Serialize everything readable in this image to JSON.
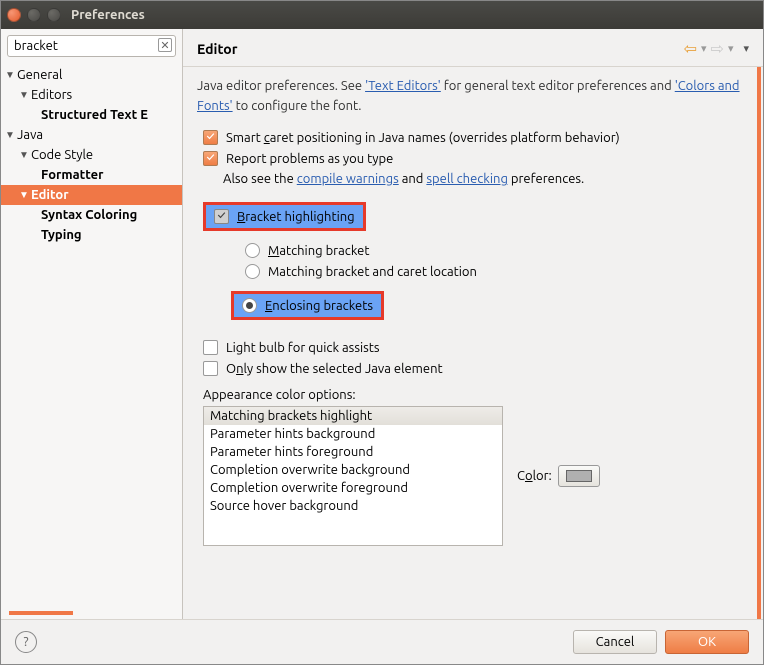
{
  "window": {
    "title": "Preferences"
  },
  "search": {
    "value": "bracket"
  },
  "tree": {
    "general": "General",
    "editors": "Editors",
    "structured": "Structured Text E",
    "java": "Java",
    "codestyle": "Code Style",
    "formatter": "Formatter",
    "editor": "Editor",
    "syntax": "Syntax Coloring",
    "typing": "Typing"
  },
  "header": {
    "title": "Editor"
  },
  "help": {
    "prefix": "Java editor preferences. See ",
    "link1": "'Text Editors'",
    "mid": " for general text editor preferences and ",
    "link2": "'Colors and Fonts'",
    "suffix": " to configure the font."
  },
  "opts": {
    "caret_pre": "Smart ",
    "caret_u": "c",
    "caret_post": "aret positioning in Java names (overrides platform behavior)",
    "report": "Report problems as you type",
    "also_pre": "Also see the ",
    "also_l1": "compile warnings",
    "also_mid": " and ",
    "also_l2": "spell checking",
    "also_post": " preferences.",
    "bracket_u": "B",
    "bracket_post": "racket highlighting",
    "matching_u": "M",
    "matching_post": "atching bracket",
    "matchloc": "Matching bracket and caret location",
    "encl_u": "E",
    "encl_post": "nclosing brackets",
    "bulb": "Light bulb for quick assists",
    "only_pre": "O",
    "only_u": "n",
    "only_post": "ly show the selected Java element"
  },
  "aco": {
    "label": "Appearance color options:",
    "items": [
      "Matching brackets highlight",
      "Parameter hints background",
      "Parameter hints foreground",
      "Completion overwrite background",
      "Completion overwrite foreground",
      "Source hover background"
    ],
    "color_pre": "C",
    "color_u": "o",
    "color_post": "lor:"
  },
  "footer": {
    "cancel": "Cancel",
    "ok": "OK"
  }
}
